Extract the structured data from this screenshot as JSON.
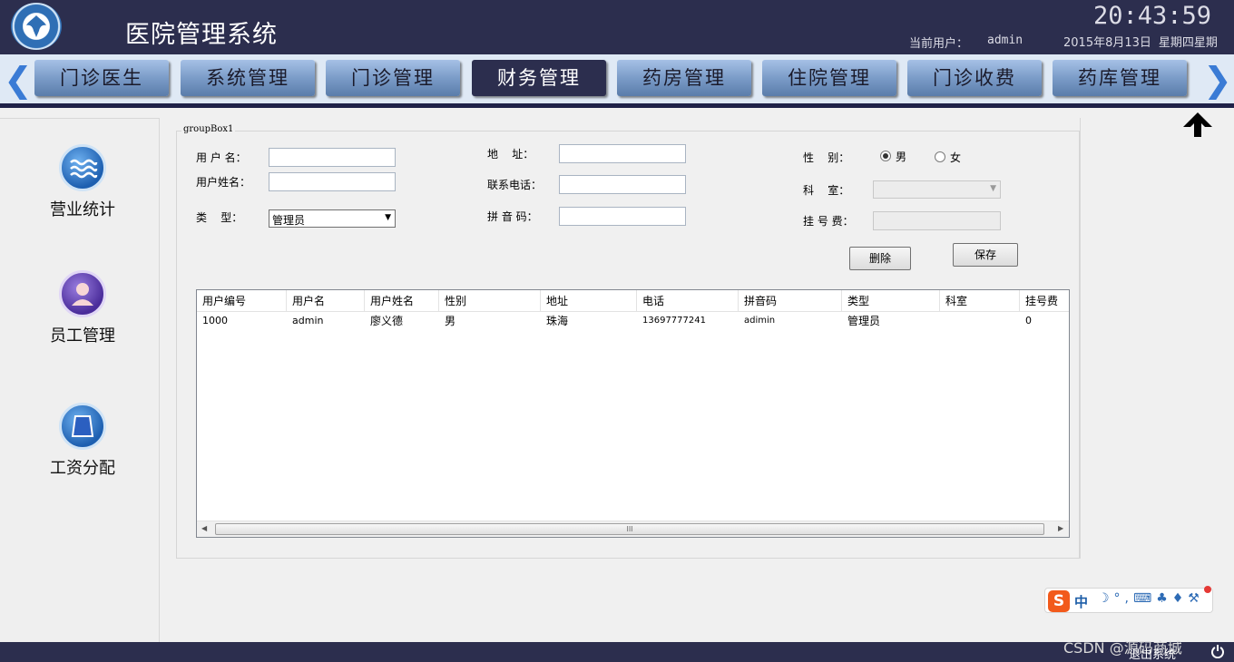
{
  "header": {
    "title": "医院管理系统",
    "clock": "20:43:59",
    "user_label": "当前用户：",
    "user_name": "admin",
    "date": "2015年8月13日",
    "weekday": "星期四星期"
  },
  "nav": {
    "tabs": [
      "门诊医生",
      "系统管理",
      "门诊管理",
      "财务管理",
      "药房管理",
      "住院管理",
      "门诊收费",
      "药库管理"
    ],
    "active_index": 3,
    "prev_icon": "chevron-left-icon",
    "next_icon": "chevron-right-icon"
  },
  "sidebar": {
    "items": [
      {
        "label": "营业统计",
        "icon": "waves-icon"
      },
      {
        "label": "员工管理",
        "icon": "person-icon"
      },
      {
        "label": "工资分配",
        "icon": "card-icon"
      }
    ]
  },
  "form": {
    "group_title": "groupBox1",
    "username_label": "用 户 名：",
    "username_value": "",
    "realname_label": "用户姓名：",
    "realname_value": "",
    "type_label": "类    型：",
    "type_value": "管理员",
    "address_label": "地    址：",
    "address_value": "",
    "phone_label": "联系电话：",
    "phone_value": "",
    "pinyin_label": "拼 音 码：",
    "pinyin_value": "",
    "gender_label": "性    别：",
    "gender_male": "男",
    "gender_female": "女",
    "gender_selected": "男",
    "dept_label": "科    室：",
    "dept_value": "",
    "fee_label": "挂 号 费：",
    "fee_value": "",
    "delete_button": "删除",
    "save_button": "保存"
  },
  "grid": {
    "columns": [
      "用户编号",
      "用户名",
      "用户姓名",
      "性别",
      "地址",
      "电话",
      "拼音码",
      "类型",
      "科室",
      "挂号费"
    ],
    "rows": [
      [
        "1000",
        "admin",
        "廖义德",
        "男",
        "珠海",
        "13697777241",
        "adimin",
        "管理员",
        "",
        "0"
      ]
    ],
    "scroll_grip": "III"
  },
  "ime": {
    "logo": "S",
    "mode": "中",
    "icons": "☽°,⌨♣♦⚒"
  },
  "footer": {
    "watermark": "CSDN @源码商城",
    "exit_label": "退出系统"
  },
  "colors": {
    "header_bg": "#2c2e4e",
    "nav_bg": "#dfe9f5",
    "tab_active": "#2c2e4e",
    "arrow_blue": "#3a7bd5"
  }
}
